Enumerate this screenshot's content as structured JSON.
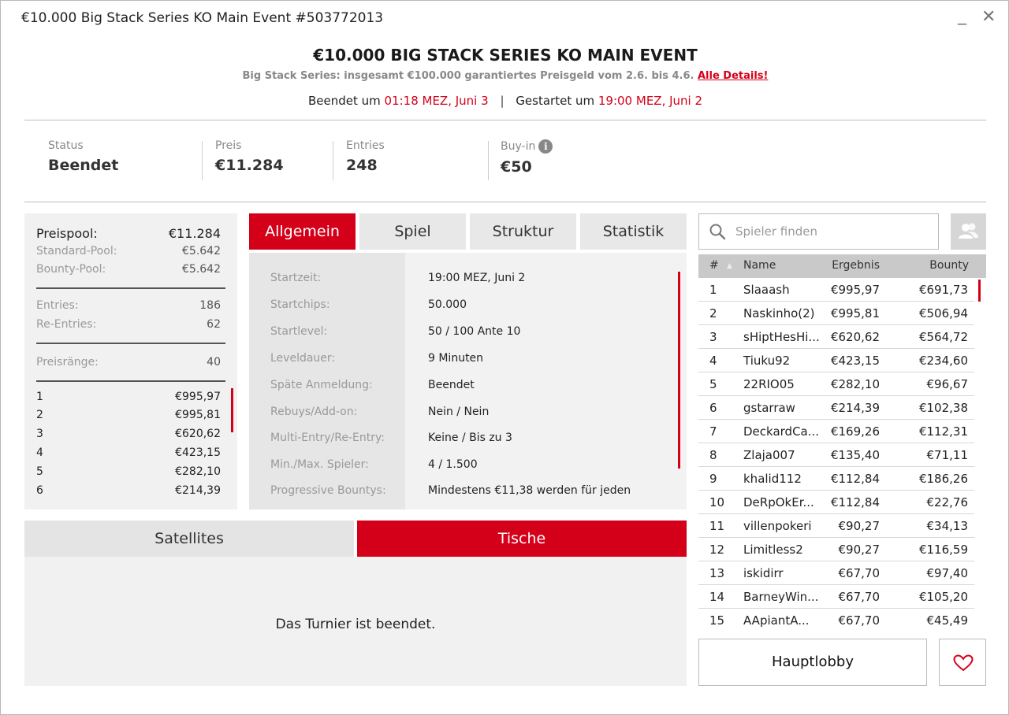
{
  "window": {
    "title": "€10.000 Big Stack Series KO Main Event #503772013",
    "minimize": "_",
    "close": "✕"
  },
  "header": {
    "title": "€10.000 BIG STACK SERIES KO MAIN EVENT",
    "subtitle": "Big Stack Series: insgesamt €100.000 garantiertes Preisgeld vom 2.6. bis 4.6.",
    "details_link": "Alle Details!",
    "ended_label": "Beendet um",
    "ended_time": "01:18 MEZ, Juni 3",
    "separator": "|",
    "started_label": "Gestartet um",
    "started_time": "19:00 MEZ, Juni 2"
  },
  "stats": {
    "status_label": "Status",
    "status_value": "Beendet",
    "prize_label": "Preis",
    "prize_value": "€11.284",
    "entries_label": "Entries",
    "entries_value": "248",
    "buyin_label": "Buy-in",
    "buyin_value": "€50"
  },
  "pool": {
    "preispool_label": "Preispool:",
    "preispool_value": "€11.284",
    "standard_label": "Standard-Pool:",
    "standard_value": "€5.642",
    "bounty_label": "Bounty-Pool:",
    "bounty_value": "€5.642",
    "entries_label": "Entries:",
    "entries_value": "186",
    "reentries_label": "Re-Entries:",
    "reentries_value": "62",
    "ranks_label": "Preisränge:",
    "ranks_value": "40",
    "payouts": [
      {
        "rank": "1",
        "amount": "€995,97"
      },
      {
        "rank": "2",
        "amount": "€995,81"
      },
      {
        "rank": "3",
        "amount": "€620,62"
      },
      {
        "rank": "4",
        "amount": "€423,15"
      },
      {
        "rank": "5",
        "amount": "€282,10"
      },
      {
        "rank": "6",
        "amount": "€214,39"
      }
    ]
  },
  "tabs": [
    {
      "label": "Allgemein",
      "active": true
    },
    {
      "label": "Spiel"
    },
    {
      "label": "Struktur"
    },
    {
      "label": "Statistik"
    }
  ],
  "details": [
    {
      "key": "Startzeit:",
      "value": "19:00 MEZ, Juni 2"
    },
    {
      "key": "Startchips:",
      "value": "50.000"
    },
    {
      "key": "Startlevel:",
      "value": "50 / 100 Ante 10"
    },
    {
      "key": "Leveldauer:",
      "value": "9 Minuten"
    },
    {
      "key": "Späte Anmeldung:",
      "value": "Beendet"
    },
    {
      "key": "Rebuys/Add-on:",
      "value": "Nein / Nein"
    },
    {
      "key": "Multi-Entry/Re-Entry:",
      "value": "Keine / Bis zu 3"
    },
    {
      "key": "Min./Max. Spieler:",
      "value": "4 / 1.500"
    },
    {
      "key": "Progressive Bountys:",
      "value": "Mindestens €11,38 werden für jeden"
    }
  ],
  "bottom_tabs": {
    "satellites": "Satellites",
    "tische": "Tische"
  },
  "bottom_message": "Das Turnier ist beendet.",
  "search": {
    "placeholder": "Spieler finden"
  },
  "players_header": {
    "rank": "#",
    "sort": "▲",
    "name": "Name",
    "result": "Ergebnis",
    "bounty": "Bounty"
  },
  "players": [
    {
      "rank": "1",
      "name": "Slaaash",
      "result": "€995,97",
      "bounty": "€691,73"
    },
    {
      "rank": "2",
      "name": "Naskinho(2)",
      "result": "€995,81",
      "bounty": "€506,94"
    },
    {
      "rank": "3",
      "name": "sHiptHesHi...",
      "result": "€620,62",
      "bounty": "€564,72"
    },
    {
      "rank": "4",
      "name": "Tiuku92",
      "result": "€423,15",
      "bounty": "€234,60"
    },
    {
      "rank": "5",
      "name": "22RIO05",
      "result": "€282,10",
      "bounty": "€96,67"
    },
    {
      "rank": "6",
      "name": "gstarraw",
      "result": "€214,39",
      "bounty": "€102,38"
    },
    {
      "rank": "7",
      "name": "DeckardCa...",
      "result": "€169,26",
      "bounty": "€112,31"
    },
    {
      "rank": "8",
      "name": "Zlaja007",
      "result": "€135,40",
      "bounty": "€71,11"
    },
    {
      "rank": "9",
      "name": "khalid112",
      "result": "€112,84",
      "bounty": "€186,26"
    },
    {
      "rank": "10",
      "name": "DeRpOkEr...",
      "result": "€112,84",
      "bounty": "€22,76"
    },
    {
      "rank": "11",
      "name": "villenpokeri",
      "result": "€90,27",
      "bounty": "€34,13"
    },
    {
      "rank": "12",
      "name": "Limitless2",
      "result": "€90,27",
      "bounty": "€116,59"
    },
    {
      "rank": "13",
      "name": "iskidirr",
      "result": "€67,70",
      "bounty": "€97,40"
    },
    {
      "rank": "14",
      "name": "BarneyWin...",
      "result": "€67,70",
      "bounty": "€105,20"
    },
    {
      "rank": "15",
      "name": "AApiantA...",
      "result": "€67,70",
      "bounty": "€45,49"
    }
  ],
  "buttons": {
    "hauptlobby": "Hauptlobby"
  },
  "colors": {
    "accent": "#d40019"
  }
}
